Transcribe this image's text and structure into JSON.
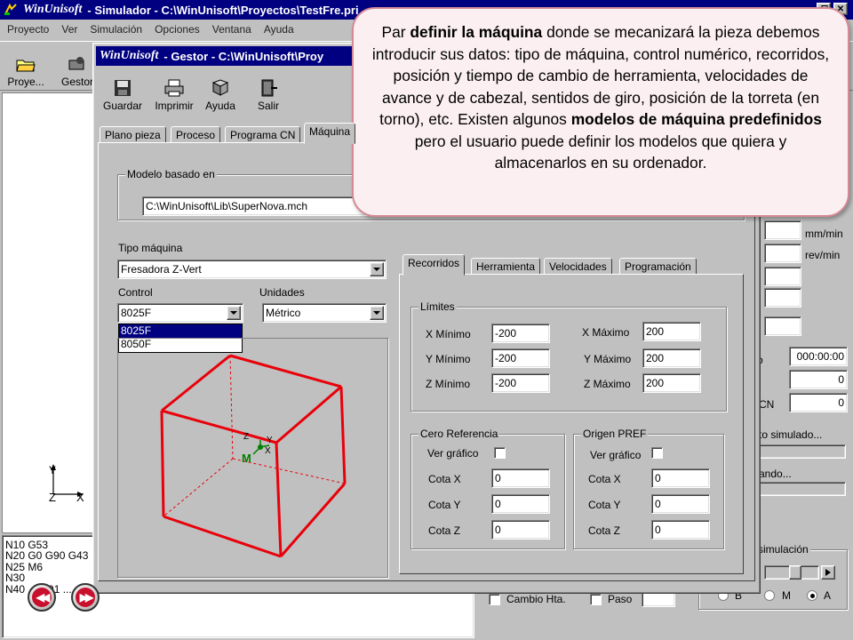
{
  "main_window": {
    "brand": "WinUnisoft",
    "title": "- Simulador - C:\\WinUnisoft\\Proyectos\\TestFre.pri"
  },
  "menu": [
    "Proyecto",
    "Ver",
    "Simulación",
    "Opciones",
    "Ventana",
    "Ayuda"
  ],
  "main_toolbar": {
    "project_label": "Proye...",
    "gestor_label": "Gestor"
  },
  "axes_view": {
    "y": "Y",
    "z": "Z",
    "x": "X"
  },
  "code_panel": {
    "lines": [
      "N10 G53",
      "N20 G0 G90 G43",
      "N25 M6",
      "N30",
      "N40 ... G91 ..."
    ]
  },
  "nav": {
    "prev": "◀◀",
    "next": "▶▶"
  },
  "gestor": {
    "brand": "WinUnisoft",
    "title": "- Gestor - C:\\WinUnisoft\\Proy",
    "toolbar": [
      {
        "label": "Guardar",
        "icon": "floppy-disk-icon"
      },
      {
        "label": "Imprimir",
        "icon": "printer-icon"
      },
      {
        "label": "Ayuda",
        "icon": "help-book-icon"
      },
      {
        "label": "Salir",
        "icon": "exit-door-icon"
      }
    ],
    "tabs": [
      "Plano pieza",
      "Proceso",
      "Programa CN",
      "Máquina"
    ],
    "modelo_basado_en": {
      "legend": "Modelo basado en",
      "path": "C:\\WinUnisoft\\Lib\\SuperNova.mch"
    },
    "tipo_maquina": {
      "label": "Tipo máquina",
      "value": "Fresadora Z-Vert"
    },
    "control": {
      "label": "Control",
      "value": "8025F",
      "options": [
        "8025F",
        "8050F"
      ]
    },
    "unidades": {
      "label": "Unidades",
      "value": "Métrico"
    },
    "preview": {
      "axis_z": "Z",
      "axis_x": "X",
      "axis_y": "Y",
      "machine_marker": "M"
    },
    "inner_tabs": [
      "Recorridos",
      "Herramienta",
      "Velocidades",
      "Programación"
    ],
    "limites": {
      "legend": "Límites",
      "x_min_label": "X Mínimo",
      "x_min": "-200",
      "y_min_label": "Y Mínimo",
      "y_min": "-200",
      "z_min_label": "Z Mínimo",
      "z_min": "-200",
      "x_max_label": "X Máximo",
      "x_max": "200",
      "y_max_label": "Y Máximo",
      "y_max": "200",
      "z_max_label": "Z Máximo",
      "z_max": "200"
    },
    "cero_referencia": {
      "legend": "Cero Referencia",
      "ver_grafico": "Ver gráfico",
      "cota_x_label": "Cota X",
      "cota_x": "0",
      "cota_y_label": "Cota Y",
      "cota_y": "0",
      "cota_z_label": "Cota Z",
      "cota_z": "0"
    },
    "origen_pref": {
      "legend": "Origen PREF",
      "ver_grafico": "Ver gráfico",
      "cota_x_label": "Cota X",
      "cota_x": "0",
      "cota_y_label": "Cota Y",
      "cota_y": "0",
      "cota_z_label": "Cota Z",
      "cota_z": "0"
    }
  },
  "right_panel": {
    "unit_feed": "mm/min",
    "unit_speed": "rev/min",
    "time_value": "000:00:00",
    "count1": "0",
    "count2": "0",
    "cn_label": "CN",
    "simulated_label": "to simulado...",
    "running_label": "ando...",
    "sim_legend": "simulación",
    "radio_b": "B",
    "radio_m": "M",
    "radio_a": "A",
    "frag_o": "o"
  },
  "bottom_bar": {
    "cambio_label": "Cambio Hta.",
    "paso_label": "Paso"
  },
  "callout": {
    "p1": "Par ",
    "b1": "definir la máquina",
    "p2": " donde se mecanizará la pieza debemos introducir sus datos: tipo de máquina, control numérico, recorridos,  posición y tiempo de cambio de herramienta, velocidades de avance y de cabezal, sentidos de giro, posición de la torreta (en torno), etc. Existen algunos ",
    "b2": "modelos de máquina predefinidos",
    "p3": " pero el usuario puede definir los modelos que quiera y almacenarlos en su ordenador."
  },
  "colors": {
    "title_bar": "#000080",
    "cube": "#e8000a",
    "callout_bg": "#fbeff1",
    "callout_border": "#d58a96",
    "selection": "#000080"
  }
}
